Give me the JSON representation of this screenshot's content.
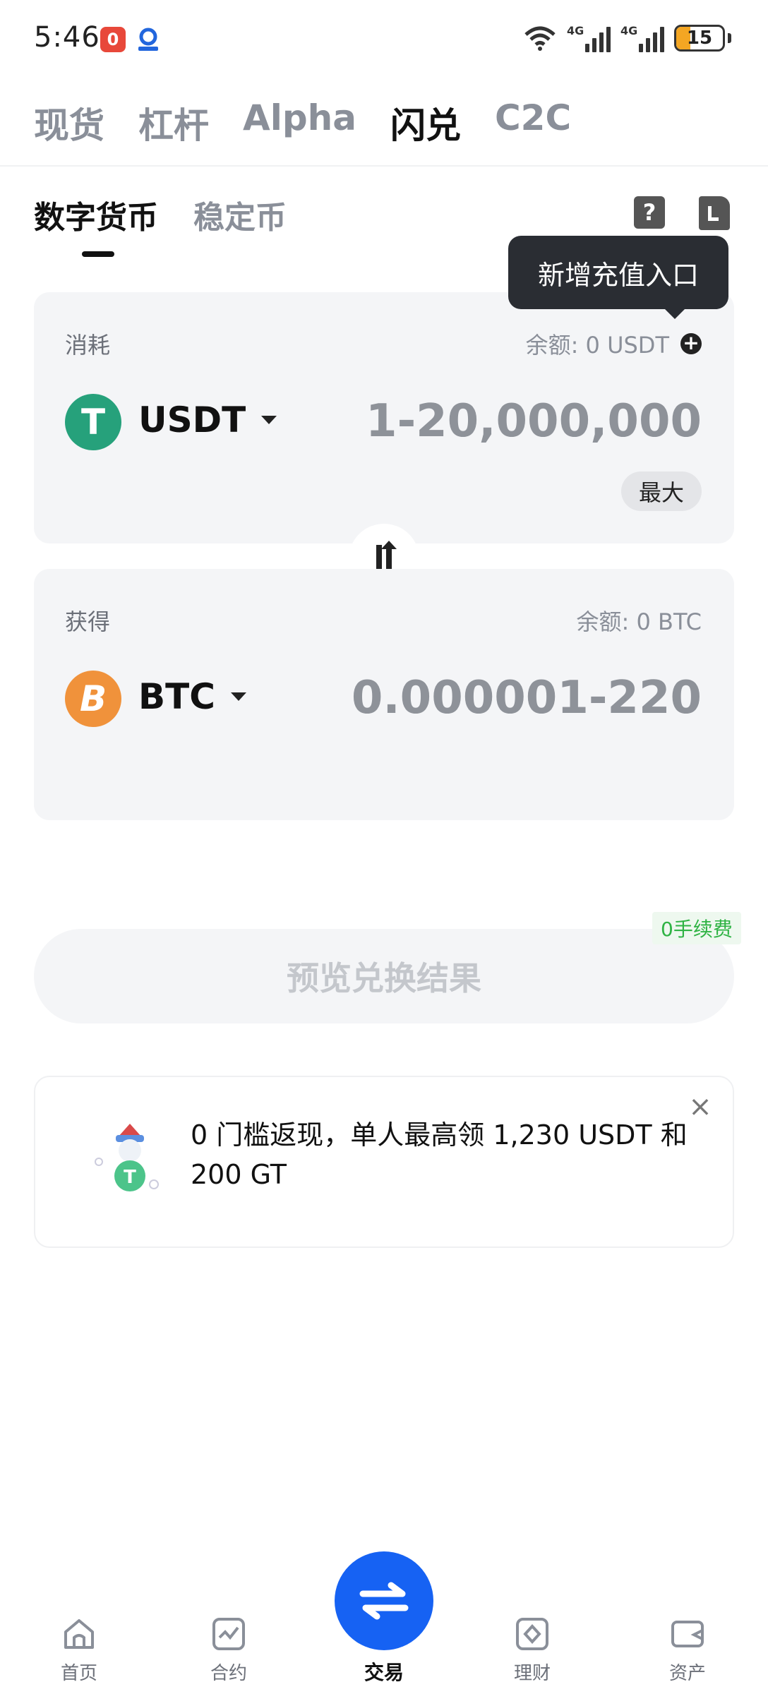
{
  "status_bar": {
    "time": "5:46",
    "notif_badge": "0",
    "network_1": "4G",
    "network_2": "4G",
    "battery": "15"
  },
  "top_tabs": [
    "现货",
    "杠杆",
    "Alpha",
    "闪兑",
    "C2C"
  ],
  "top_tabs_active": "闪兑",
  "sub_tabs": [
    "数字货币",
    "稳定币"
  ],
  "sub_tabs_active": "数字货币",
  "help_icon": "?",
  "tooltip": "新增充值入口",
  "pay": {
    "label": "消耗",
    "balance": "余额: 0 USDT",
    "currency": "USDT",
    "amount_range": "1-20,000,000",
    "max_label": "最大",
    "coin_symbol": "T"
  },
  "receive": {
    "label": "获得",
    "balance": "余额: 0 BTC",
    "currency": "BTC",
    "amount_range": "0.000001-220",
    "coin_symbol": "B"
  },
  "fee_badge": "0手续费",
  "preview_button": "预览兑换结果",
  "promo": {
    "text": "0 门槛返现，单人最高领 1,230 USDT 和 200 GT",
    "close": "×"
  },
  "bottom_nav": {
    "items": [
      "首页",
      "合约",
      "交易",
      "理财",
      "资产"
    ]
  },
  "colors": {
    "accent": "#1662f3",
    "usdt": "#26a17b",
    "btc": "#f0923b",
    "fee_green": "#2fb344"
  }
}
